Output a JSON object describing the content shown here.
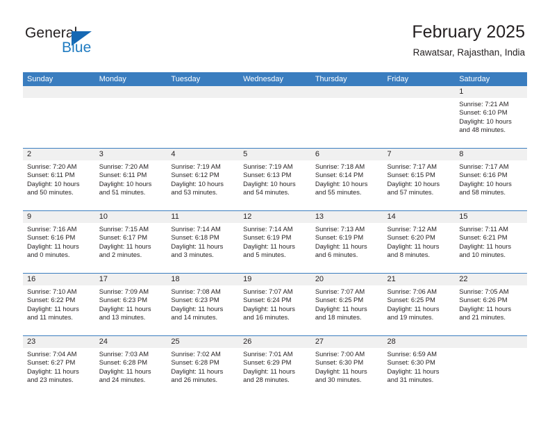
{
  "brand": {
    "name_part1": "General",
    "name_part2": "Blue",
    "logo_icon": "triangle-flag-icon",
    "accent_color": "#1668b3"
  },
  "header": {
    "title": "February 2025",
    "subtitle": "Rawatsar, Rajasthan, India"
  },
  "calendar": {
    "header_bg": "#3a7dbf",
    "day_band_bg": "#f0f0f0",
    "weekday_headers": [
      "Sunday",
      "Monday",
      "Tuesday",
      "Wednesday",
      "Thursday",
      "Friday",
      "Saturday"
    ],
    "weeks": [
      [
        {
          "day": "",
          "empty": true
        },
        {
          "day": "",
          "empty": true
        },
        {
          "day": "",
          "empty": true
        },
        {
          "day": "",
          "empty": true
        },
        {
          "day": "",
          "empty": true
        },
        {
          "day": "",
          "empty": true
        },
        {
          "day": "1",
          "sunrise": "Sunrise: 7:21 AM",
          "sunset": "Sunset: 6:10 PM",
          "daylight": "Daylight: 10 hours and 48 minutes."
        }
      ],
      [
        {
          "day": "2",
          "sunrise": "Sunrise: 7:20 AM",
          "sunset": "Sunset: 6:11 PM",
          "daylight": "Daylight: 10 hours and 50 minutes."
        },
        {
          "day": "3",
          "sunrise": "Sunrise: 7:20 AM",
          "sunset": "Sunset: 6:11 PM",
          "daylight": "Daylight: 10 hours and 51 minutes."
        },
        {
          "day": "4",
          "sunrise": "Sunrise: 7:19 AM",
          "sunset": "Sunset: 6:12 PM",
          "daylight": "Daylight: 10 hours and 53 minutes."
        },
        {
          "day": "5",
          "sunrise": "Sunrise: 7:19 AM",
          "sunset": "Sunset: 6:13 PM",
          "daylight": "Daylight: 10 hours and 54 minutes."
        },
        {
          "day": "6",
          "sunrise": "Sunrise: 7:18 AM",
          "sunset": "Sunset: 6:14 PM",
          "daylight": "Daylight: 10 hours and 55 minutes."
        },
        {
          "day": "7",
          "sunrise": "Sunrise: 7:17 AM",
          "sunset": "Sunset: 6:15 PM",
          "daylight": "Daylight: 10 hours and 57 minutes."
        },
        {
          "day": "8",
          "sunrise": "Sunrise: 7:17 AM",
          "sunset": "Sunset: 6:16 PM",
          "daylight": "Daylight: 10 hours and 58 minutes."
        }
      ],
      [
        {
          "day": "9",
          "sunrise": "Sunrise: 7:16 AM",
          "sunset": "Sunset: 6:16 PM",
          "daylight": "Daylight: 11 hours and 0 minutes."
        },
        {
          "day": "10",
          "sunrise": "Sunrise: 7:15 AM",
          "sunset": "Sunset: 6:17 PM",
          "daylight": "Daylight: 11 hours and 2 minutes."
        },
        {
          "day": "11",
          "sunrise": "Sunrise: 7:14 AM",
          "sunset": "Sunset: 6:18 PM",
          "daylight": "Daylight: 11 hours and 3 minutes."
        },
        {
          "day": "12",
          "sunrise": "Sunrise: 7:14 AM",
          "sunset": "Sunset: 6:19 PM",
          "daylight": "Daylight: 11 hours and 5 minutes."
        },
        {
          "day": "13",
          "sunrise": "Sunrise: 7:13 AM",
          "sunset": "Sunset: 6:19 PM",
          "daylight": "Daylight: 11 hours and 6 minutes."
        },
        {
          "day": "14",
          "sunrise": "Sunrise: 7:12 AM",
          "sunset": "Sunset: 6:20 PM",
          "daylight": "Daylight: 11 hours and 8 minutes."
        },
        {
          "day": "15",
          "sunrise": "Sunrise: 7:11 AM",
          "sunset": "Sunset: 6:21 PM",
          "daylight": "Daylight: 11 hours and 10 minutes."
        }
      ],
      [
        {
          "day": "16",
          "sunrise": "Sunrise: 7:10 AM",
          "sunset": "Sunset: 6:22 PM",
          "daylight": "Daylight: 11 hours and 11 minutes."
        },
        {
          "day": "17",
          "sunrise": "Sunrise: 7:09 AM",
          "sunset": "Sunset: 6:23 PM",
          "daylight": "Daylight: 11 hours and 13 minutes."
        },
        {
          "day": "18",
          "sunrise": "Sunrise: 7:08 AM",
          "sunset": "Sunset: 6:23 PM",
          "daylight": "Daylight: 11 hours and 14 minutes."
        },
        {
          "day": "19",
          "sunrise": "Sunrise: 7:07 AM",
          "sunset": "Sunset: 6:24 PM",
          "daylight": "Daylight: 11 hours and 16 minutes."
        },
        {
          "day": "20",
          "sunrise": "Sunrise: 7:07 AM",
          "sunset": "Sunset: 6:25 PM",
          "daylight": "Daylight: 11 hours and 18 minutes."
        },
        {
          "day": "21",
          "sunrise": "Sunrise: 7:06 AM",
          "sunset": "Sunset: 6:25 PM",
          "daylight": "Daylight: 11 hours and 19 minutes."
        },
        {
          "day": "22",
          "sunrise": "Sunrise: 7:05 AM",
          "sunset": "Sunset: 6:26 PM",
          "daylight": "Daylight: 11 hours and 21 minutes."
        }
      ],
      [
        {
          "day": "23",
          "sunrise": "Sunrise: 7:04 AM",
          "sunset": "Sunset: 6:27 PM",
          "daylight": "Daylight: 11 hours and 23 minutes."
        },
        {
          "day": "24",
          "sunrise": "Sunrise: 7:03 AM",
          "sunset": "Sunset: 6:28 PM",
          "daylight": "Daylight: 11 hours and 24 minutes."
        },
        {
          "day": "25",
          "sunrise": "Sunrise: 7:02 AM",
          "sunset": "Sunset: 6:28 PM",
          "daylight": "Daylight: 11 hours and 26 minutes."
        },
        {
          "day": "26",
          "sunrise": "Sunrise: 7:01 AM",
          "sunset": "Sunset: 6:29 PM",
          "daylight": "Daylight: 11 hours and 28 minutes."
        },
        {
          "day": "27",
          "sunrise": "Sunrise: 7:00 AM",
          "sunset": "Sunset: 6:30 PM",
          "daylight": "Daylight: 11 hours and 30 minutes."
        },
        {
          "day": "28",
          "sunrise": "Sunrise: 6:59 AM",
          "sunset": "Sunset: 6:30 PM",
          "daylight": "Daylight: 11 hours and 31 minutes."
        },
        {
          "day": "",
          "empty": true
        }
      ]
    ]
  }
}
